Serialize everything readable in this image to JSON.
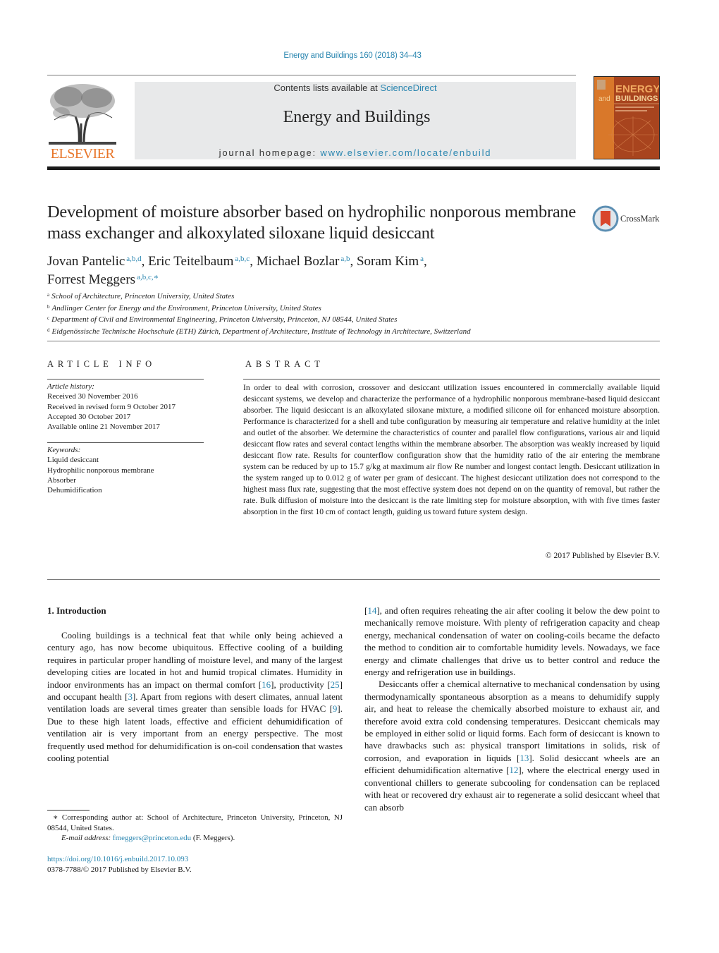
{
  "header": {
    "citation": "Energy and Buildings 160 (2018) 34–43",
    "contents_prefix": "Contents lists available at ",
    "contents_link": "ScienceDirect",
    "journal_name": "Energy and Buildings",
    "homepage_prefix": "journal homepage: ",
    "homepage_link": "www.elsevier.com/locate/enbuild",
    "publisher_logo_text": "ELSEVIER",
    "cover": {
      "title_line1": "ENERGY",
      "title_and": "and",
      "title_line2": "BUILDINGS",
      "colors": {
        "left_panel": "#d9782a",
        "main": "#a8441e",
        "accent_text": "#f4d19a"
      }
    },
    "crossmark_label": "CrossMark"
  },
  "colors": {
    "link": "#2a86b0",
    "elsevier_orange": "#e8762a",
    "band_gray": "#e8e9ea"
  },
  "article": {
    "title": "Development of moisture absorber based on hydrophilic nonporous membrane mass exchanger and alkoxylated siloxane liquid desiccant",
    "authors": [
      {
        "name": "Jovan Pantelic",
        "affil": "a,b,d",
        "sep": ", "
      },
      {
        "name": "Eric Teitelbaum",
        "affil": "a,b,c",
        "sep": ", "
      },
      {
        "name": "Michael Bozlar",
        "affil": "a,b",
        "sep": ", "
      },
      {
        "name": "Soram Kim",
        "affil": "a",
        "sep": ","
      },
      {
        "name": "Forrest Meggers",
        "affil": "a,b,c,∗",
        "sep": ""
      }
    ],
    "affiliations": [
      {
        "mark": "a",
        "text": "School of Architecture, Princeton University, United States"
      },
      {
        "mark": "b",
        "text": "Andlinger Center for Energy and the Environment, Princeton University, United States"
      },
      {
        "mark": "c",
        "text": "Department of Civil and Environmental Engineering, Princeton University, Princeton, NJ 08544, United States"
      },
      {
        "mark": "d",
        "text": "Eidgenössische Technische Hochschule (ETH) Zürich, Department of Architecture, Institute of Technology in Architecture, Switzerland"
      }
    ]
  },
  "article_info": {
    "heading": "ARTICLE INFO",
    "history_label": "Article history:",
    "history": [
      "Received 30 November 2016",
      "Received in revised form 9 October 2017",
      "Accepted 30 October 2017",
      "Available online 21 November 2017"
    ],
    "keywords_label": "Keywords:",
    "keywords": [
      "Liquid desiccant",
      "Hydrophilic nonporous membrane",
      "Absorber",
      "Dehumidification"
    ]
  },
  "abstract": {
    "heading": "ABSTRACT",
    "text": "In order to deal with corrosion, crossover and desiccant utilization issues encountered in commercially available liquid desiccant systems, we develop and characterize the performance of a hydrophilic nonporous membrane-based liquid desiccant absorber. The liquid desiccant is an alkoxylated siloxane mixture, a modified silicone oil for enhanced moisture absorption. Performance is characterized for a shell and tube configuration by measuring air temperature and relative humidity at the inlet and outlet of the absorber. We determine the characteristics of counter and parallel flow configurations, various air and liquid desiccant flow rates and several contact lengths within the membrane absorber. The absorption was weakly increased by liquid desiccant flow rate. Results for counterflow configuration show that the humidity ratio of the air entering the membrane system can be reduced by up to 15.7 g/kg at maximum air flow Re number and longest contact length. Desiccant utilization in the system ranged up to 0.012 g of water per gram of desiccant. The highest desiccant utilization does not correspond to the highest mass flux rate, suggesting that the most effective system does not depend on on the quantity of removal, but rather the rate. Bulk diffusion of moisture into the desiccant is the rate limiting step for moisture absorption, with with five times faster absorption in the first 10 cm of contact length, guiding us toward future system design.",
    "copyright": "© 2017 Published by Elsevier B.V."
  },
  "introduction": {
    "heading": "1.  Introduction",
    "left": {
      "p1_a": "Cooling buildings is a technical feat that while only being achieved a century ago, has now become ubiquitous. Effective cooling of a building requires in particular proper handling of moisture level, and many of the largest developing cities are located in hot and humid tropical climates. Humidity in indoor environments has an impact on thermal comfort [",
      "ref16": "16",
      "p1_b": "], productivity [",
      "ref25": "25",
      "p1_c": "] and occupant health [",
      "ref3": "3",
      "p1_d": "]. Apart from regions with desert climates, annual latent ventilation loads are several times greater than sensible loads for HVAC [",
      "ref9": "9",
      "p1_e": "]. Due to these high latent loads, effective and efficient dehumidification of ventilation air is very important from an energy perspective. The most frequently used method for dehumidification is on-coil condensation that wastes cooling potential"
    },
    "right": {
      "p1_pre": "[",
      "ref14": "14",
      "p1_a": "], and often requires reheating the air after cooling it below the dew point to mechanically remove moisture. With plenty of refrigeration capacity and cheap energy, mechanical condensation of water on cooling-coils became the defacto the method to condition air to comfortable humidity levels. Nowadays, we face energy and climate challenges that drive us to better control and reduce the energy and refrigeration use in buildings.",
      "p2_a": "Desiccants offer a chemical alternative to mechanical condensation by using thermodynamically spontaneous absorption as a means to dehumidify supply air, and heat to release the chemically absorbed moisture to exhaust air, and therefore avoid extra cold condensing temperatures. Desiccant chemicals may be employed in either solid or liquid forms. Each form of desiccant is known to have drawbacks such as: physical transport limitations in solids, risk of corrosion, and evaporation in liquids [",
      "ref13": "13",
      "p2_b": "]. Solid desiccant wheels are an efficient dehumidification alternative [",
      "ref12": "12",
      "p2_c": "], where the electrical energy used in conventional chillers to generate subcooling for condensation can be replaced with heat or recovered dry exhaust air to regenerate a solid desiccant wheel that can absorb"
    }
  },
  "footnote": {
    "corresponding": "∗  Corresponding author at: School of Architecture, Princeton University, Princeton, NJ 08544, United States.",
    "email_label": "E-mail address: ",
    "email": "fmeggers@princeton.edu",
    "email_suffix": " (F. Meggers)."
  },
  "doi": {
    "link": "https://doi.org/10.1016/j.enbuild.2017.10.093",
    "issn_line": "0378-7788/© 2017 Published by Elsevier B.V."
  }
}
